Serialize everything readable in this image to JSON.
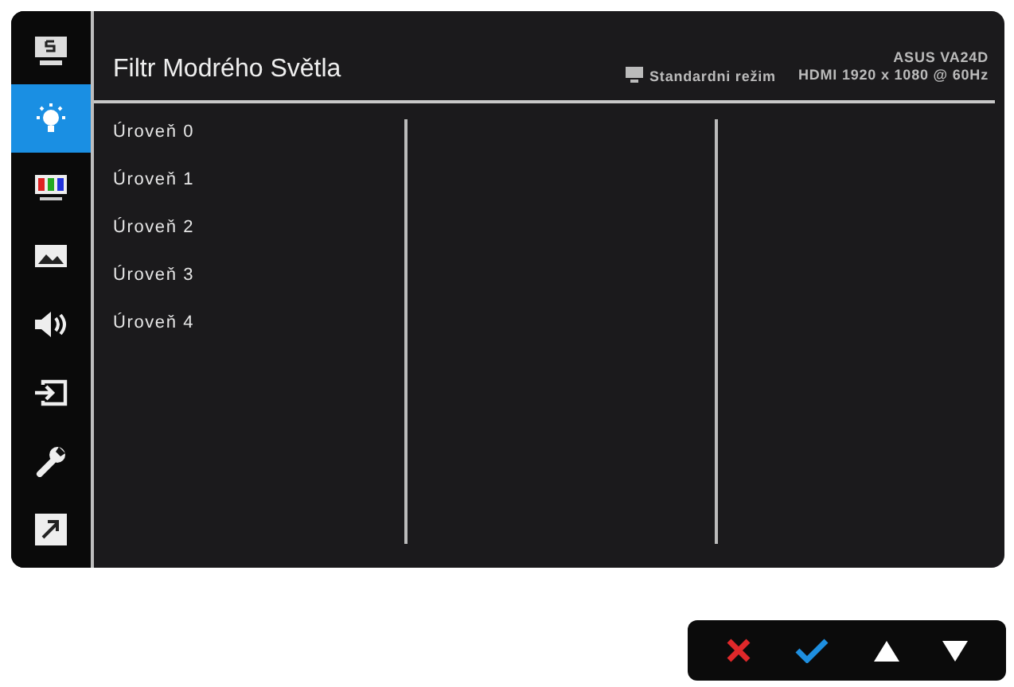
{
  "sidebar": {
    "items": [
      {
        "kind": "splendid",
        "selected": false
      },
      {
        "kind": "bluelight",
        "selected": true
      },
      {
        "kind": "color",
        "selected": false
      },
      {
        "kind": "image",
        "selected": false
      },
      {
        "kind": "sound",
        "selected": false
      },
      {
        "kind": "input",
        "selected": false
      },
      {
        "kind": "system",
        "selected": false
      },
      {
        "kind": "shortcut",
        "selected": false
      }
    ]
  },
  "header": {
    "title": "Filtr Modrého Světla",
    "mode": "Standardni režim",
    "model": "ASUS VA24D",
    "signal": "HDMI 1920 x 1080 @ 60Hz"
  },
  "options": [
    {
      "label": "Úroveň 0"
    },
    {
      "label": "Úroveň 1"
    },
    {
      "label": "Úroveň 2"
    },
    {
      "label": "Úroveň 3"
    },
    {
      "label": "Úroveň 4"
    }
  ],
  "keys": [
    {
      "kind": "close"
    },
    {
      "kind": "ok"
    },
    {
      "kind": "up"
    },
    {
      "kind": "down"
    }
  ]
}
